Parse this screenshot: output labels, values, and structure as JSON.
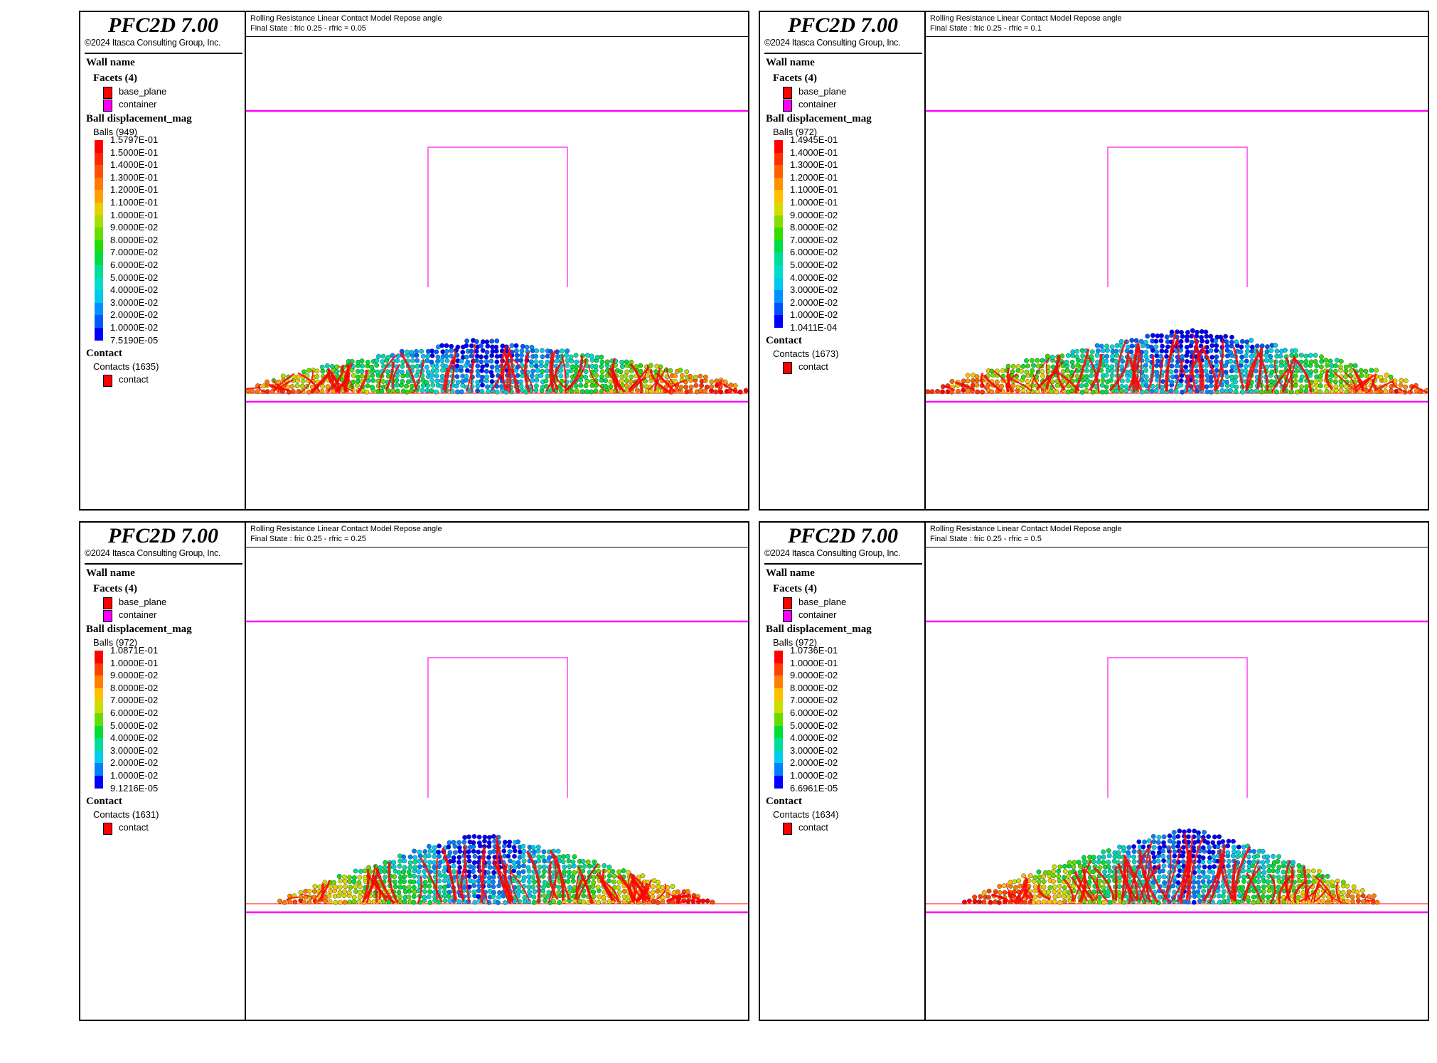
{
  "common": {
    "app_title": "PFC2D 7.00",
    "copyright": "©2024 Itasca Consulting Group, Inc.",
    "wall_name_label": "Wall name",
    "facets_label": "Facets (4)",
    "facet_items": [
      "base_plane",
      "container"
    ],
    "ball_label": "Ball displacement_mag",
    "contact_label": "Contact",
    "contact_item": "contact",
    "view_title": "Rolling Resistance Linear Contact Model  Repose angle",
    "colors": {
      "wall": "#ff00ff",
      "container_box": "#ff44ee",
      "contact": "#ff0000",
      "base_plane": "#ff0000"
    }
  },
  "panels": [
    {
      "id": "top-left",
      "subtitle": "Final State : fric 0.25 - rfric = 0.05",
      "balls_label": "Balls (949)",
      "contacts_label": "Contacts (1635)",
      "scale": [
        "1.5797E-01",
        "1.5000E-01",
        "1.4000E-01",
        "1.3000E-01",
        "1.2000E-01",
        "1.1000E-01",
        "1.0000E-01",
        "9.0000E-02",
        "8.0000E-02",
        "7.0000E-02",
        "6.0000E-02",
        "5.0000E-02",
        "4.0000E-02",
        "3.0000E-02",
        "2.0000E-02",
        "1.0000E-02",
        "7.5190E-05"
      ],
      "scale_colors": [
        "#ff0000",
        "#ff2800",
        "#ff5000",
        "#ff7800",
        "#ffa000",
        "#e6d000",
        "#aadd00",
        "#66dd00",
        "#22dd00",
        "#00dd44",
        "#00dd99",
        "#00ddcc",
        "#00c8ee",
        "#0090ff",
        "#0058ff",
        "#0000ff"
      ]
    },
    {
      "id": "top-right",
      "subtitle": "Final State : fric 0.25 - rfric = 0.1",
      "balls_label": "Balls (972)",
      "contacts_label": "Contacts (1673)",
      "scale": [
        "1.4945E-01",
        "1.4000E-01",
        "1.3000E-01",
        "1.2000E-01",
        "1.1000E-01",
        "1.0000E-01",
        "9.0000E-02",
        "8.0000E-02",
        "7.0000E-02",
        "6.0000E-02",
        "5.0000E-02",
        "4.0000E-02",
        "3.0000E-02",
        "2.0000E-02",
        "1.0000E-02",
        "1.0411E-04"
      ],
      "scale_colors": [
        "#ff0000",
        "#ff3000",
        "#ff6000",
        "#ff9000",
        "#ffc000",
        "#d8dd00",
        "#88dd00",
        "#33dd00",
        "#00dd44",
        "#00dd99",
        "#00ddcc",
        "#00c8ee",
        "#0090ff",
        "#0050ff",
        "#0000ff"
      ]
    },
    {
      "id": "bottom-left",
      "subtitle": "Final State : fric 0.25 - rfric = 0.25",
      "balls_label": "Balls (972)",
      "contacts_label": "Contacts (1631)",
      "scale": [
        "1.0871E-01",
        "1.0000E-01",
        "9.0000E-02",
        "8.0000E-02",
        "7.0000E-02",
        "6.0000E-02",
        "5.0000E-02",
        "4.0000E-02",
        "3.0000E-02",
        "2.0000E-02",
        "1.0000E-02",
        "9.1216E-05"
      ],
      "scale_colors": [
        "#ff0000",
        "#ff4000",
        "#ff8000",
        "#ffc000",
        "#ccdd00",
        "#66dd00",
        "#00dd33",
        "#00dd99",
        "#00ccee",
        "#0080ff",
        "#0000ff"
      ]
    },
    {
      "id": "bottom-right",
      "subtitle": "Final State : fric 0.25 - rfric = 0.5",
      "balls_label": "Balls (972)",
      "contacts_label": "Contacts (1634)",
      "scale": [
        "1.0736E-01",
        "1.0000E-01",
        "9.0000E-02",
        "8.0000E-02",
        "7.0000E-02",
        "6.0000E-02",
        "5.0000E-02",
        "4.0000E-02",
        "3.0000E-02",
        "2.0000E-02",
        "1.0000E-02",
        "6.6961E-05"
      ],
      "scale_colors": [
        "#ff0000",
        "#ff4000",
        "#ff8000",
        "#ffc000",
        "#ccdd00",
        "#66dd00",
        "#00dd33",
        "#00dd99",
        "#00ccee",
        "#0080ff",
        "#0000ff"
      ]
    }
  ]
}
